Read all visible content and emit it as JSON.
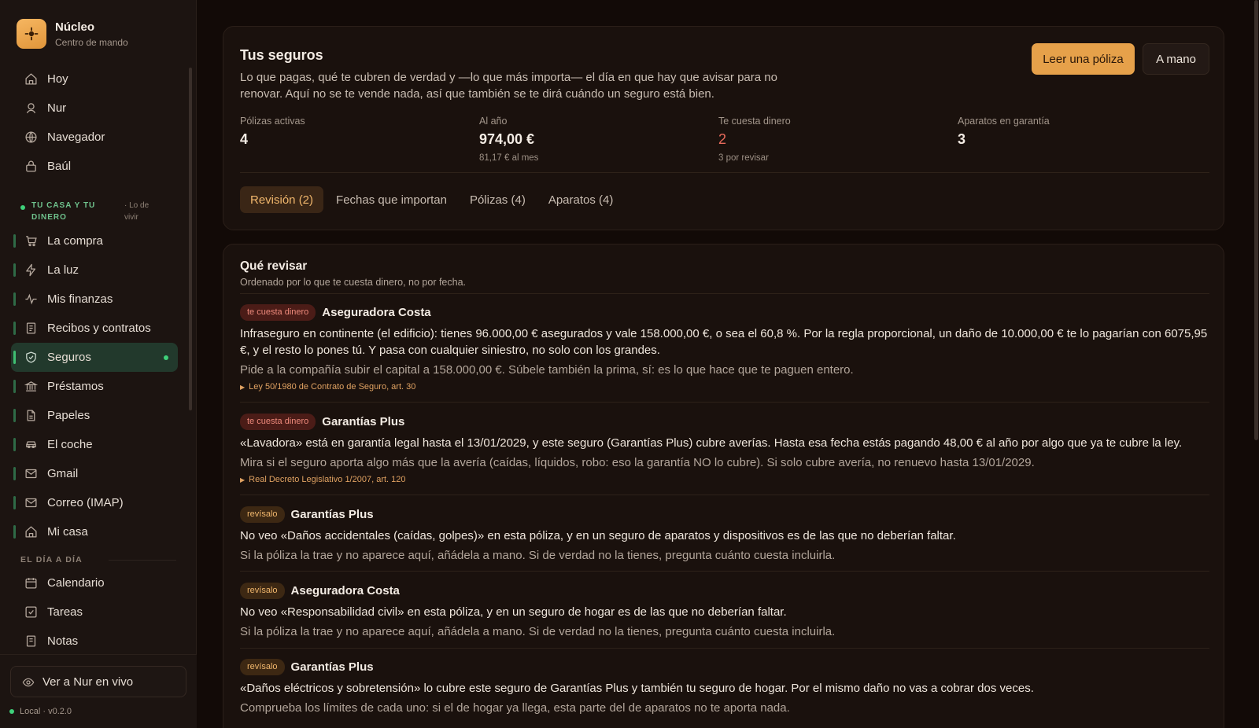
{
  "brand": {
    "title": "Núcleo",
    "subtitle": "Centro de mando"
  },
  "nav_top": [
    {
      "label": "Hoy",
      "icon": "home-icon"
    },
    {
      "label": "Nur",
      "icon": "user-icon"
    },
    {
      "label": "Navegador",
      "icon": "globe-icon"
    },
    {
      "label": "Baúl",
      "icon": "lock-icon"
    }
  ],
  "section1": {
    "title": "TU CASA Y TU DINERO",
    "aside": "· Lo de vivir"
  },
  "nav_section1": [
    {
      "label": "La compra",
      "icon": "cart-icon"
    },
    {
      "label": "La luz",
      "icon": "bolt-icon"
    },
    {
      "label": "Mis finanzas",
      "icon": "activity-icon"
    },
    {
      "label": "Recibos y contratos",
      "icon": "receipt-icon"
    },
    {
      "label": "Seguros",
      "icon": "shield-icon",
      "active": true
    },
    {
      "label": "Préstamos",
      "icon": "bank-icon"
    },
    {
      "label": "Papeles",
      "icon": "file-icon"
    },
    {
      "label": "El coche",
      "icon": "car-icon"
    },
    {
      "label": "Gmail",
      "icon": "mail-icon"
    },
    {
      "label": "Correo (IMAP)",
      "icon": "mail-icon"
    },
    {
      "label": "Mi casa",
      "icon": "home-icon"
    }
  ],
  "section2": {
    "title": "EL DÍA A DÍA"
  },
  "nav_section2": [
    {
      "label": "Calendario",
      "icon": "calendar-icon"
    },
    {
      "label": "Tareas",
      "icon": "checkbox-icon"
    },
    {
      "label": "Notas",
      "icon": "note-icon"
    }
  ],
  "footer": {
    "live_label": "Ver a Nur en vivo",
    "version": "Local · v0.2.0"
  },
  "header": {
    "title": "Tus seguros",
    "intro": "Lo que pagas, qué te cubren de verdad y —lo que más importa— el día en que hay que avisar para no renovar. Aquí no se te vende nada, así que también se te dirá cuándo un seguro está bien.",
    "primary_button": "Leer una póliza",
    "secondary_button": "A mano"
  },
  "stats": [
    {
      "label": "Pólizas activas",
      "value": "4",
      "sub": ""
    },
    {
      "label": "Al año",
      "value": "974,00 €",
      "sub": "81,17 € al mes"
    },
    {
      "label": "Te cuesta dinero",
      "value": "2",
      "sub": "3 por revisar"
    },
    {
      "label": "Aparatos en garantía",
      "value": "3",
      "sub": ""
    }
  ],
  "tabs": [
    {
      "label": "Revisión (2)",
      "active": true
    },
    {
      "label": "Fechas que importan"
    },
    {
      "label": "Pólizas (4)"
    },
    {
      "label": "Aparatos (4)"
    }
  ],
  "review": {
    "title": "Qué revisar",
    "subtitle": "Ordenado por lo que te cuesta dinero, no por fecha.",
    "items": [
      {
        "badge": "te cuesta dinero",
        "name": "Aseguradora Costa",
        "text": "Infraseguro en continente (el edificio): tienes 96.000,00 € asegurados y vale 158.000,00 €, o sea el 60,8 %. Por la regla proporcional, un daño de 10.000,00 € te lo pagarían con 6075,95 €, y el resto lo pones tú. Y pasa con cualquier siniestro, no solo con los grandes.",
        "advice": "Pide a la compañía subir el capital a 158.000,00 €. Súbele también la prima, sí: es lo que hace que te paguen entero.",
        "law": "Ley 50/1980 de Contrato de Seguro, art. 30"
      },
      {
        "badge": "te cuesta dinero",
        "name": "Garantías Plus",
        "text": "«Lavadora» está en garantía legal hasta el 13/01/2029, y este seguro (Garantías Plus) cubre averías. Hasta esa fecha estás pagando 48,00 € al año por algo que ya te cubre la ley.",
        "advice": "Mira si el seguro aporta algo más que la avería (caídas, líquidos, robo: eso la garantía NO lo cubre). Si solo cubre avería, no renuevo hasta 13/01/2029.",
        "law": "Real Decreto Legislativo 1/2007, art. 120"
      },
      {
        "badge": "revísalo",
        "name": "Garantías Plus",
        "text": "No veo «Daños accidentales (caídas, golpes)» en esta póliza, y en un seguro de aparatos y dispositivos es de las que no deberían faltar.",
        "advice": "Si la póliza la trae y no aparece aquí, añádela a mano. Si de verdad no la tienes, pregunta cuánto cuesta incluirla."
      },
      {
        "badge": "revísalo",
        "name": "Aseguradora Costa",
        "text": "No veo «Responsabilidad civil» en esta póliza, y en un seguro de hogar es de las que no deberían faltar.",
        "advice": "Si la póliza la trae y no aparece aquí, añádela a mano. Si de verdad no la tienes, pregunta cuánto cuesta incluirla."
      },
      {
        "badge": "revísalo",
        "name": "Garantías Plus",
        "text": "«Daños eléctricos y sobretensión» lo cubre este seguro de Garantías Plus y también tu seguro de hogar. Por el mismo daño no vas a cobrar dos veces.",
        "advice": "Comprueba los límites de cada uno: si el de hogar ya llega, esta parte del de aparatos no te aporta nada."
      }
    ]
  }
}
